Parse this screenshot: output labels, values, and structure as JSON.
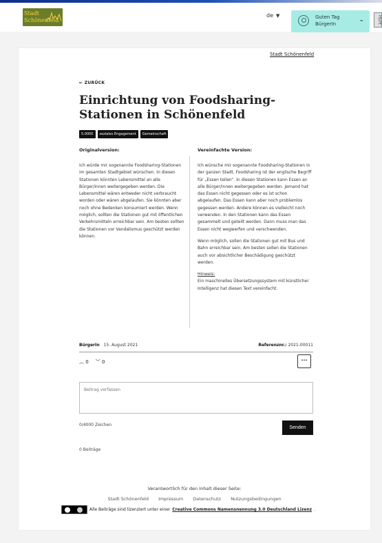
{
  "header": {
    "logo_line1": "Stadt",
    "logo_line2": "Schönenfeld",
    "language": "de",
    "greeting_line1": "Guten Tag",
    "greeting_line2": "BürgerIn",
    "side_tab": "HILFE"
  },
  "breadcrumb": {
    "label": "Stadt Schönenfeld"
  },
  "back_label": "← ZURÜCK",
  "post": {
    "title": "Einrichtung von Foodsharing-Stationen in Schönenfeld",
    "tags": [
      "5.000€",
      "soziales Engagement",
      "Gemeinschaft"
    ],
    "original_heading": "Originalversion:",
    "original_text": "Ich würde mir sogenannte Foodsharing-Stationen im gesamten Stadtgebiet wünschen. In diesen Stationen könnten Lebensmittel an alle Bürger/innen weitergegeben werden. Die Lebensmittel wären entweder nicht verbraucht worden oder wären abgelaufen. Sie könnten aber noch ohne Bedenken konsumiert werden. Wenn möglich, sollten die Stationen gut mit öffentlichen Verkehrsmitteln erreichbar sein. Am besten sollten die Stationen vor Vandalismus geschützt werden können.",
    "simplified_heading": "Vereinfachte Version:",
    "simplified_p1": "Ich wünsche mir sogenannte Foodsharing-Stationen in der ganzen Stadt. Foodsharing ist der englische Begriff für „Essen teilen“. In diesen Stationen kann Essen an alle Bürger/innen weitergegeben werden. Jemand hat das Essen nicht gegessen oder es ist schon abgelaufen. Das Essen kann aber noch problemlos gegessen werden. Andere können es vielleicht noch verwenden. In den Stationen kann das Essen gesammelt und geteilt werden. Dann muss man das Essen nicht wegwerfen und verschwenden.",
    "simplified_p2": "Wenn möglich, sollen die Stationen gut mit Bus und Bahn erreichbar sein. Am besten sollen die Stationen auch vor absichtlicher Beschädigung geschützt werden.",
    "hint_label": "Hinweis:",
    "hint_text": "Ein maschinelles Übersetzungssystem mit künstlicher Intelligenz hat diesen Text vereinfacht.",
    "author": "BürgerIn",
    "date": "15. August 2021",
    "ref_label": "Referenznr.:",
    "ref_value": "2021-00011",
    "upvotes": "0",
    "downvotes": "0"
  },
  "comment": {
    "placeholder": "Beitrag verfassen",
    "char_count": "0/4000 Zeichen",
    "send_label": "Senden",
    "posts_count": "0 Beiträge"
  },
  "footer": {
    "responsible": "Verantwortlich für den Inhalt dieser Seite:",
    "links": [
      "Stadt Schönenfeld",
      "Impressum",
      "Datenschutz",
      "Nutzungsbedingungen"
    ],
    "license_prefix": "Alle Beiträge sind lizenziert unter einer",
    "license_link": "Creative Commons Namensnennung 3.0 Deutschland Lizenz"
  }
}
